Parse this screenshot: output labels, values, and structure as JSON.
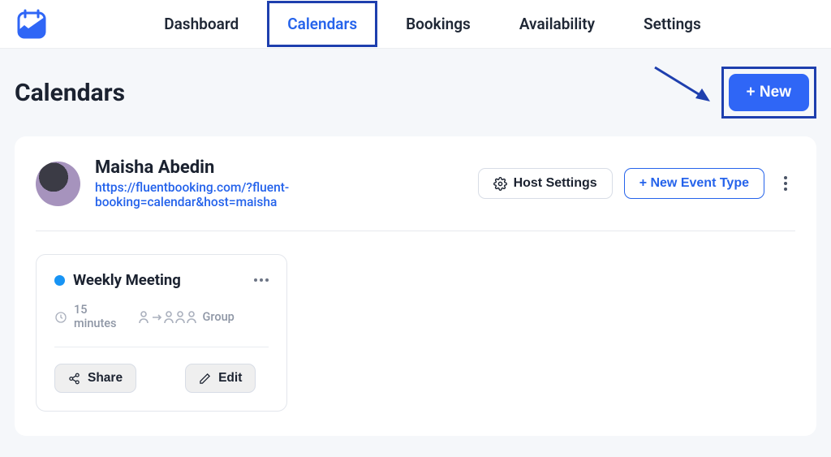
{
  "nav": {
    "items": [
      {
        "label": "Dashboard"
      },
      {
        "label": "Calendars"
      },
      {
        "label": "Bookings"
      },
      {
        "label": "Availability"
      },
      {
        "label": "Settings"
      }
    ],
    "activeIndex": 1
  },
  "page": {
    "title": "Calendars",
    "newButton": "+  New"
  },
  "host": {
    "name": "Maisha Abedin",
    "url": "https://fluentbooking.com/?fluent-booking=calendar&host=maisha",
    "hostSettingsLabel": "Host Settings",
    "newEventTypeLabel": "+  New Event Type"
  },
  "events": [
    {
      "title": "Weekly Meeting",
      "durationValue": "15",
      "durationUnit": "minutes",
      "type": "Group",
      "shareLabel": "Share",
      "editLabel": "Edit",
      "color": "#1894f4"
    }
  ]
}
